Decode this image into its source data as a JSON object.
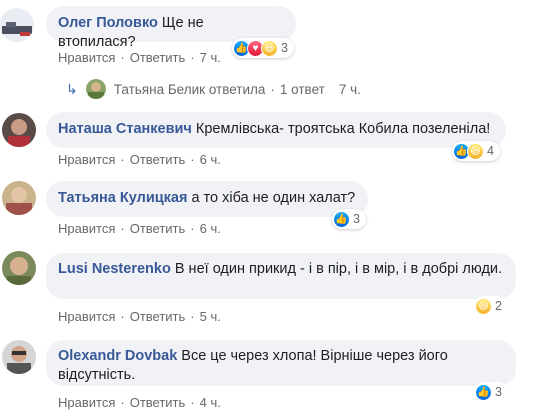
{
  "comments": [
    {
      "author": "Олег Половко",
      "text": "Ще не втопилася?",
      "like_label": "Нравится",
      "reply_label": "Ответить",
      "time": "7 ч.",
      "reactions": [
        "like-icon",
        "love-icon",
        "haha-icon"
      ],
      "reaction_count": "3"
    },
    {
      "author": "Наташа Станкевич",
      "text": "Кремлівська- троятська Кобила позеленіла!",
      "like_label": "Нравится",
      "reply_label": "Ответить",
      "time": "6 ч.",
      "reactions": [
        "like-icon",
        "haha-icon"
      ],
      "reaction_count": "4"
    },
    {
      "author": "Татьяна Кулицкая",
      "text": "а то хіба не один халат?",
      "like_label": "Нравится",
      "reply_label": "Ответить",
      "time": "6 ч.",
      "reactions": [
        "like-icon"
      ],
      "reaction_count": "3"
    },
    {
      "author": "Lusi Nesterenko",
      "text": "В неї один прикид - і в пір, і в мір, і в добрі люди.",
      "like_label": "Нравится",
      "reply_label": "Ответить",
      "time": "5 ч.",
      "reactions": [
        "haha-icon"
      ],
      "reaction_count": "2"
    },
    {
      "author": "Olexandr Dovbak",
      "text": "Все це через хлопа! Вірніше через його відсутність.",
      "like_label": "Нравится",
      "reply_label": "Ответить",
      "time": "4 ч.",
      "reactions": [
        "like-icon"
      ],
      "reaction_count": "3"
    }
  ],
  "reply_summary": {
    "author_action": "Татьяна Белик ответила",
    "reply_count": "1 ответ",
    "time": "7 ч."
  },
  "colors": {
    "author": "#385898",
    "bubble": "#f0f2f5",
    "meta": "#65676b"
  }
}
